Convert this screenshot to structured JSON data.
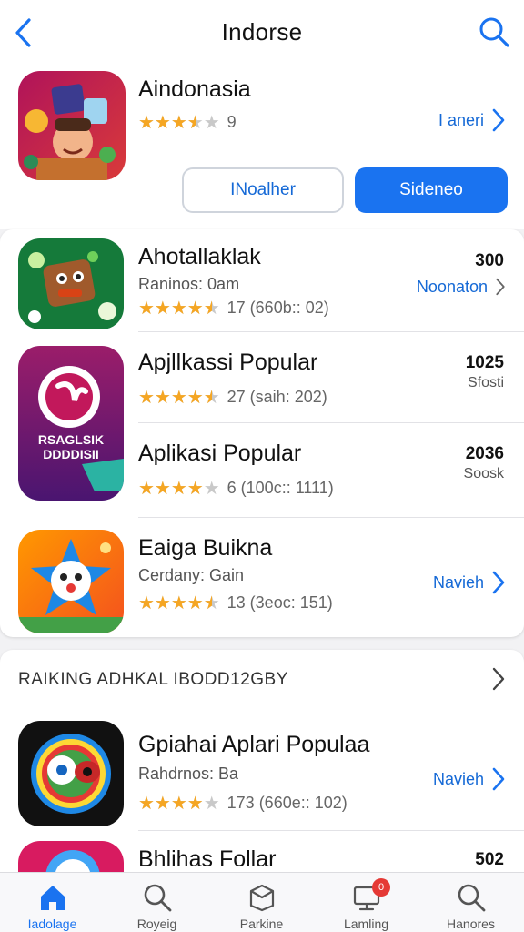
{
  "nav": {
    "title": "Indorse",
    "back_icon": "chevron-left-icon",
    "search_icon": "search-icon"
  },
  "featured": {
    "name": "Aindonasia",
    "rating": 3.5,
    "rating_text": "9",
    "link_label": "I aneri",
    "button_outline": "INoalher",
    "button_fill": "Sideneo"
  },
  "list1": [
    {
      "name": "Ahotallaklak",
      "subtitle": "Raninos: 0am",
      "rating": 4.5,
      "rating_text": "17  (660b:: 02)",
      "price": "300",
      "link_label": "Noonaton"
    },
    {
      "name": "Apjllkassi Popular",
      "rating": 4.5,
      "rating_text": "27  (saih: 202)",
      "price": "1025",
      "price_sub": "Sfosti"
    },
    {
      "name": "Aplikasi Popular",
      "rating": 4.0,
      "rating_text": "6  (100c:: 1111)",
      "price": "2036",
      "price_sub": "Soosk",
      "icon_text": "RSAGLSIK DDDDISII"
    },
    {
      "name": "Eaiga Buikna",
      "subtitle": "Cerdany: Gain",
      "rating": 4.5,
      "rating_text": "13  (3eoc: 151)",
      "link_label": "Navieh"
    }
  ],
  "section": {
    "title": "RAIKING ADHKAL IBODD12GBY"
  },
  "list2": [
    {
      "name": "Gpiahai Aplari Populaa",
      "subtitle": "Rahdrnos: Ba",
      "rating": 4.0,
      "rating_text": "173  (660e:: 102)",
      "link_label": "Navieh"
    },
    {
      "name": "Bhlihas Follar",
      "price": "502"
    }
  ],
  "tabbar": {
    "tabs": [
      {
        "label": "Iadolage",
        "icon": "home-icon"
      },
      {
        "label": "Royeig",
        "icon": "search-icon"
      },
      {
        "label": "Parkine",
        "icon": "box-icon"
      },
      {
        "label": "Lamling",
        "icon": "monitor-icon",
        "badge": "0"
      },
      {
        "label": "Hanores",
        "icon": "search-icon"
      }
    ]
  },
  "colors": {
    "accent": "#1a73f0",
    "star": "#f5a623",
    "badge": "#e53935"
  }
}
